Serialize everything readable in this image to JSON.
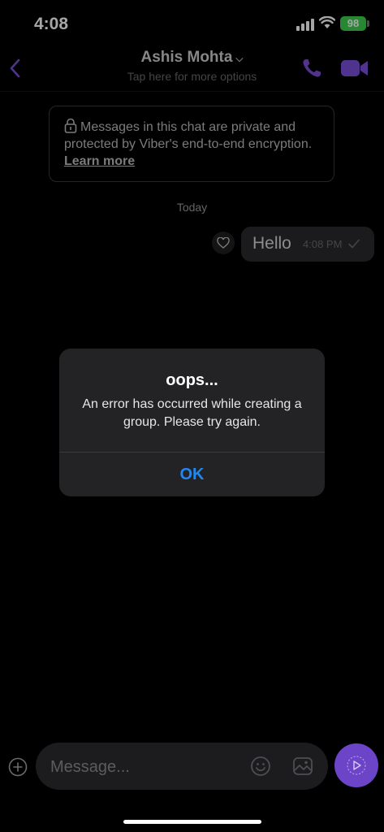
{
  "status_bar": {
    "time": "4:08",
    "battery": "98"
  },
  "header": {
    "contact_name": "Ashis Mohta",
    "subtitle": "Tap here for more options",
    "icons": {
      "back": "chevron-left-icon",
      "call": "phone-icon",
      "video": "video-camera-icon"
    },
    "accent_color": "#7a4fd8"
  },
  "encryption_notice": {
    "text": "Messages in this chat are private and protected by Viber's end-to-end encryption.",
    "link": "Learn more"
  },
  "date_separator": "Today",
  "messages": [
    {
      "text": "Hello",
      "time": "4:08 PM",
      "status": "delivered",
      "outgoing": true
    }
  ],
  "alert": {
    "title": "oops...",
    "message": "An error has occurred while creating a group. Please try again.",
    "button": "OK",
    "button_color": "#1e88f5"
  },
  "composer": {
    "placeholder": "Message...",
    "send_color": "#6b44c8"
  }
}
